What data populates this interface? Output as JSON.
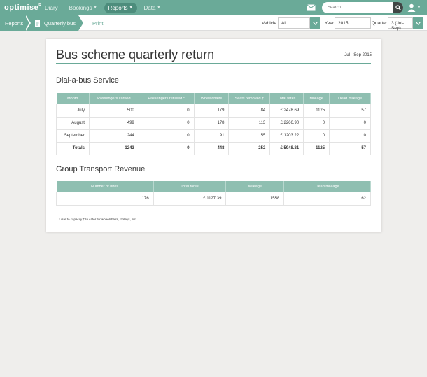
{
  "nav": {
    "logo": "optimise",
    "logo_sup": "R",
    "items": [
      {
        "label": "Diary"
      },
      {
        "label": "Bookings"
      },
      {
        "label": "Reports"
      },
      {
        "label": "Data"
      }
    ],
    "search_placeholder": "Search"
  },
  "breadcrumb": {
    "reports": "Reports",
    "quarterly_bus": "Quarterly bus",
    "print": "Print"
  },
  "filters": {
    "vehicle_label": "Vehicle",
    "vehicle_value": "All",
    "year_label": "Year",
    "year_value": "2015",
    "quarter_label": "Quarter",
    "quarter_value": "3 (Jul-Sep)"
  },
  "report": {
    "title": "Bus scheme quarterly return",
    "period": "Jul - Sep 2015",
    "dial_title": "Dial-a-bus Service",
    "dial_headers": [
      "Month",
      "Passengers carried",
      "Passengers refused *",
      "Wheelchairs",
      "Seats removed †",
      "Total fares",
      "Mileage",
      "Dead mileage"
    ],
    "dial_rows": [
      [
        "July",
        "500",
        "0",
        "179",
        "84",
        "£ 2478.69",
        "1125",
        "57"
      ],
      [
        "August",
        "499",
        "0",
        "178",
        "113",
        "£ 2266.90",
        "0",
        "0"
      ],
      [
        "September",
        "244",
        "0",
        "91",
        "55",
        "£ 1203.22",
        "0",
        "0"
      ]
    ],
    "dial_totals": [
      "Totals",
      "1243",
      "0",
      "448",
      "252",
      "£ 5948.81",
      "1125",
      "57"
    ],
    "group_title": "Group Transport Revenue",
    "group_headers": [
      "Number of hires",
      "Total fares",
      "Mileage",
      "Dead mileage"
    ],
    "group_rows": [
      [
        "176",
        "£ 1127.39",
        "1558",
        "62"
      ]
    ],
    "footnote": "* due to capacity   † to cater for wheelchairs, trolleys, etc"
  }
}
